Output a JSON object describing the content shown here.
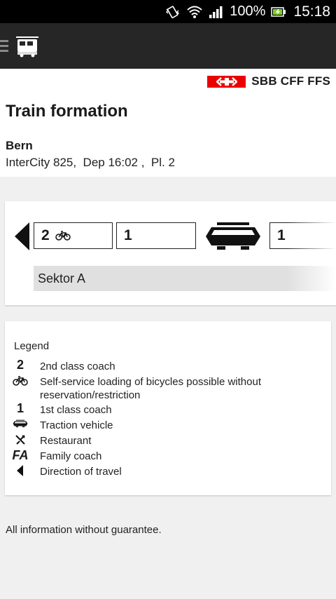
{
  "status_bar": {
    "battery": "100%",
    "time": "15:18",
    "icons": [
      "vibrate-icon",
      "wifi-icon",
      "signal-icon",
      "battery-icon"
    ]
  },
  "action_bar": {
    "menu_icon": "hamburger-icon",
    "app_icon": "train-icon"
  },
  "header": {
    "brand": "SBB CFF FFS",
    "brand_color": "#eb0000",
    "title": "Train formation",
    "station": "Bern",
    "train_info": "InterCity 825,  Dep 16:02 ,  Pl. 2"
  },
  "formation": {
    "direction_icon": "direction-arrow-icon",
    "coaches": [
      {
        "label": "2",
        "icon": "bicycle-icon"
      },
      {
        "label": "1"
      },
      {
        "type": "traction-vehicle-icon"
      },
      {
        "label": "1"
      }
    ],
    "sector": "Sektor A"
  },
  "legend": {
    "title": "Legend",
    "items": [
      {
        "symbol": "2",
        "text": "2nd class coach"
      },
      {
        "symbol": "bicycle-icon",
        "text": "Self-service loading of bicycles possible without reservation/restriction"
      },
      {
        "symbol": "1",
        "text": "1st class coach"
      },
      {
        "symbol": "traction-vehicle-icon",
        "text": "Traction vehicle"
      },
      {
        "symbol": "restaurant-icon",
        "text": "Restaurant"
      },
      {
        "symbol": "FA",
        "text": "Family coach"
      },
      {
        "symbol": "direction-arrow-icon",
        "text": "Direction of travel"
      }
    ]
  },
  "disclaimer": "All information without guarantee."
}
